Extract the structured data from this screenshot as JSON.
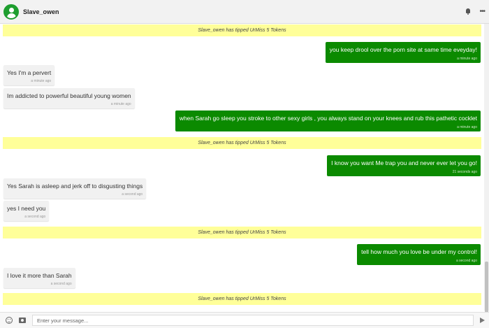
{
  "header": {
    "username": "Slave_owen",
    "icons": [
      "user-avatar-icon",
      "bell-icon",
      "more-options-icon"
    ]
  },
  "messages": [
    {
      "type": "tip",
      "text": "Slave_owen has tipped UrMiss 5 Tokens"
    },
    {
      "type": "outgoing",
      "text": "you keep drool over the porn site at same time eveyday!",
      "time": "a minute ago"
    },
    {
      "type": "incoming",
      "text": "Yes I'm a pervert",
      "time": "a minute ago"
    },
    {
      "type": "incoming",
      "text": "Im addicted to powerful beautiful young women",
      "time": "a minute ago"
    },
    {
      "type": "outgoing",
      "text": "when Sarah go sleep you stroke to other sexy girls , you always stand on your knees and rub this pathetic cocklet",
      "time": "a minute ago"
    },
    {
      "type": "tip",
      "text": "Slave_owen has tipped UrMiss 5 Tokens"
    },
    {
      "type": "outgoing",
      "text": "I know you want Me trap you and never ever let you go!",
      "time": "21 seconds ago"
    },
    {
      "type": "incoming",
      "text": "Yes Sarah is asleep and jerk off to disgusting things",
      "time": "a second ago"
    },
    {
      "type": "incoming",
      "text": "yes I need you",
      "time": "a second ago"
    },
    {
      "type": "tip",
      "text": "Slave_owen has tipped UrMiss 5 Tokens"
    },
    {
      "type": "outgoing",
      "text": "tell how much you love be under my control!",
      "time": "a second ago"
    },
    {
      "type": "incoming",
      "text": "I love it more than Sarah",
      "time": "a second ago"
    },
    {
      "type": "tip",
      "text": "Slave_owen has tipped UrMiss 5 Tokens"
    }
  ],
  "composer": {
    "placeholder": "Enter your message...",
    "icons": [
      "emoji-icon",
      "camera-icon",
      "send-icon"
    ]
  },
  "colors": {
    "outgoing_bubble": "#0b8a00",
    "tip_banner": "#ffff99",
    "incoming_bubble": "#f1f1f1"
  }
}
